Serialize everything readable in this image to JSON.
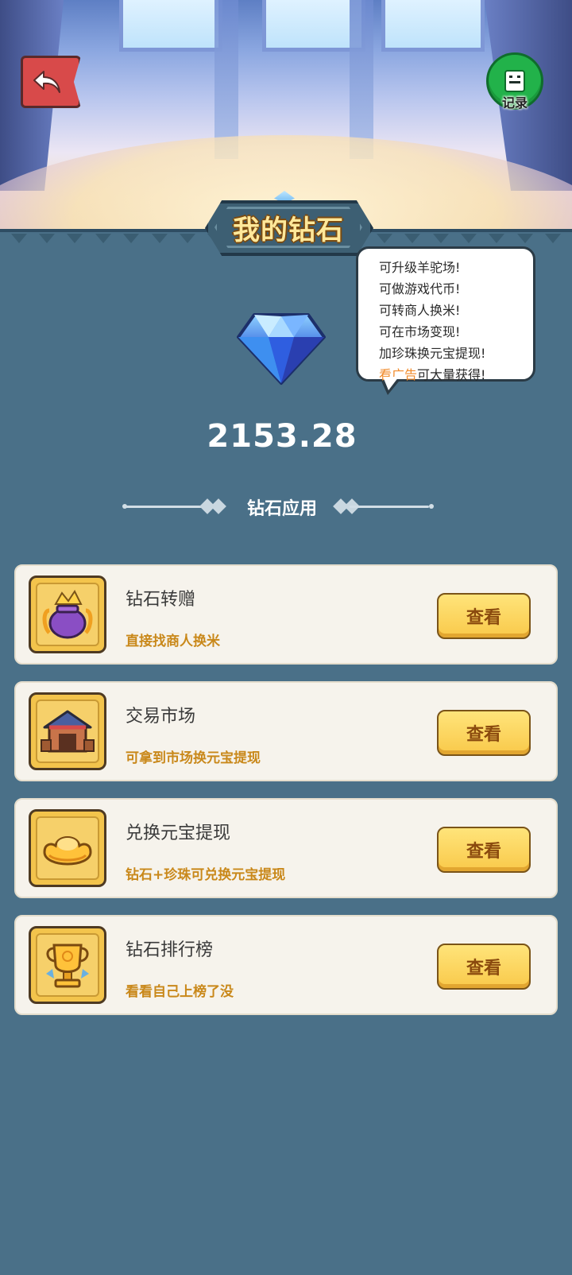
{
  "header": {
    "record_label": "记录",
    "page_title": "我的钻石"
  },
  "balance": {
    "amount": "2153.28"
  },
  "tips": {
    "lines": [
      "可升级羊驼场!",
      "可做游戏代币!",
      "可转商人换米!",
      "可在市场变现!",
      "加珍珠换元宝提现!"
    ],
    "last_highlight": "看广告",
    "last_rest": "可大量获得!"
  },
  "section": {
    "title": "钻石应用"
  },
  "apps": [
    {
      "title": "钻石转赠",
      "subtitle": "直接找商人换米",
      "button": "查看",
      "icon": "gift-bag-icon"
    },
    {
      "title": "交易市场",
      "subtitle": "可拿到市场换元宝提现",
      "button": "查看",
      "icon": "market-stall-icon"
    },
    {
      "title": "兑换元宝提现",
      "subtitle": "钻石+珍珠可兑换元宝提现",
      "button": "查看",
      "icon": "gold-ingot-icon"
    },
    {
      "title": "钻石排行榜",
      "subtitle": "看看自己上榜了没",
      "button": "查看",
      "icon": "trophy-icon"
    }
  ],
  "colors": {
    "panel_bg": "#4a7088",
    "accent_orange": "#f08a2a",
    "subtitle_gold": "#c9881a",
    "button_yellow": "#f9c94a",
    "back_red": "#d84a4a",
    "record_green": "#22b24a"
  }
}
